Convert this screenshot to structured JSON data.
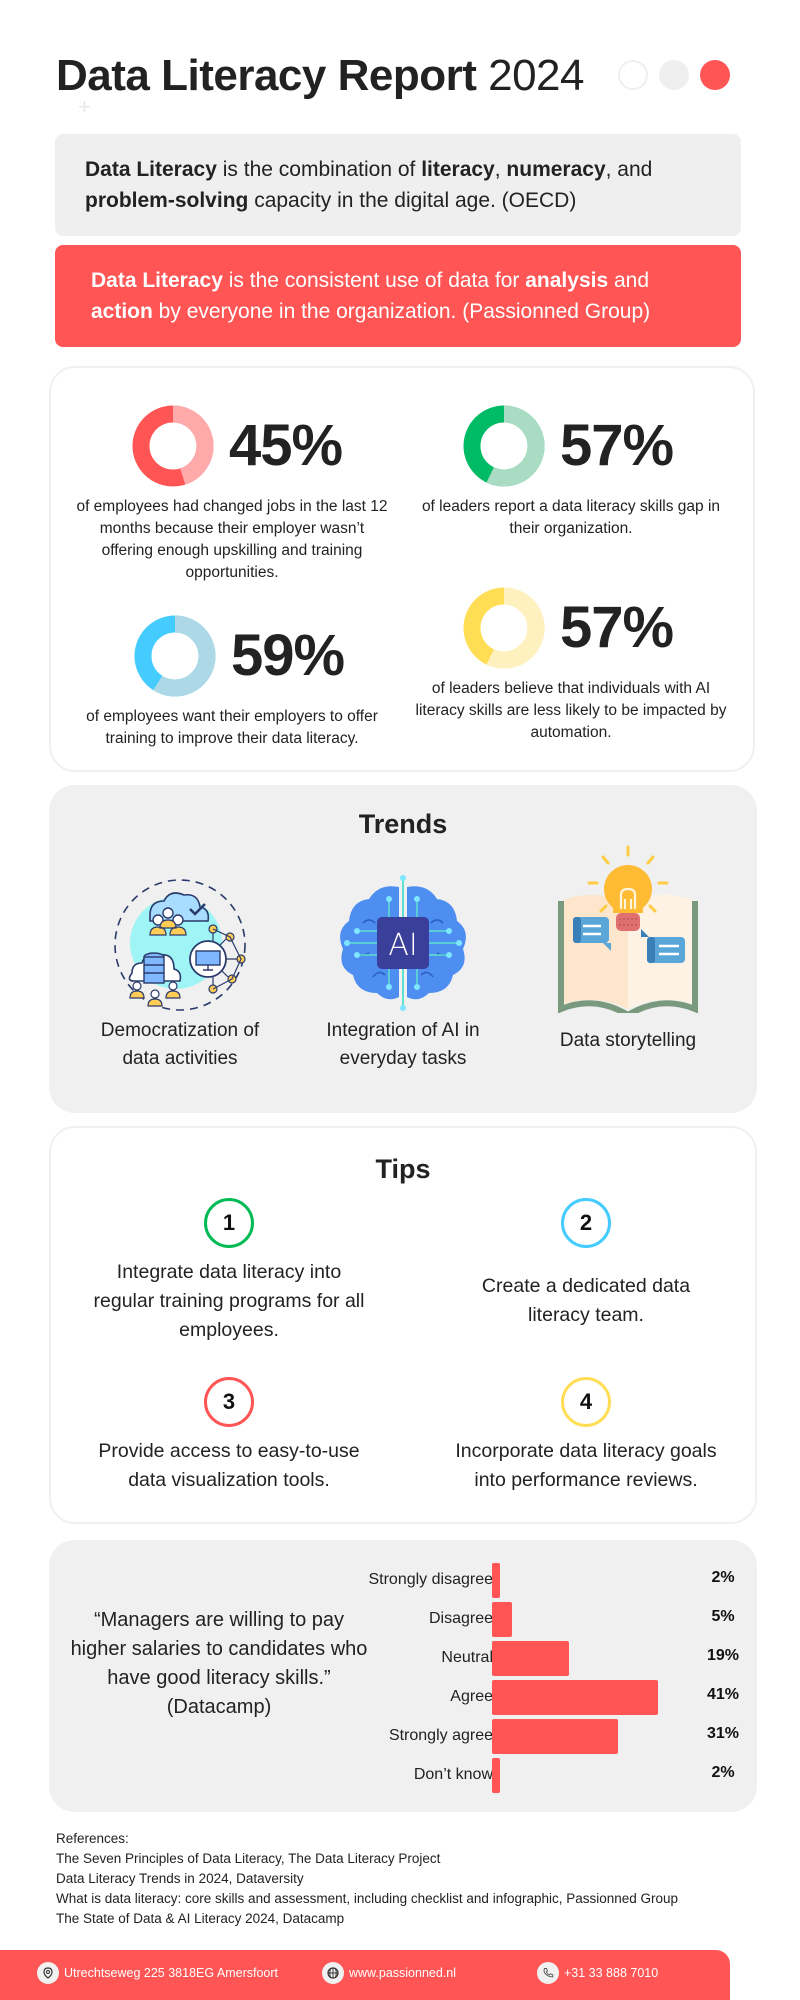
{
  "header": {
    "title_bold": "Data Literacy Report",
    "title_year": "2024",
    "decor_dots": [
      "#ffffff",
      "#efefef",
      "#ff5555"
    ]
  },
  "definitions": {
    "oecd": {
      "parts": [
        {
          "t": "Data Literacy",
          "b": true
        },
        {
          "t": " is the combination of ",
          "b": false
        },
        {
          "t": "literacy",
          "b": true
        },
        {
          "t": ", ",
          "b": false
        },
        {
          "t": "numeracy",
          "b": true
        },
        {
          "t": ", and ",
          "b": false
        },
        {
          "t": "problem-solving",
          "b": true
        },
        {
          "t": " capacity in the digital age. (OECD)",
          "b": false
        }
      ]
    },
    "passionned": {
      "parts": [
        {
          "t": "Data Literacy",
          "b": true
        },
        {
          "t": " is the consistent use of data for ",
          "b": false
        },
        {
          "t": "analysis",
          "b": true
        },
        {
          "t": " and ",
          "b": false
        },
        {
          "t": "action",
          "b": true
        },
        {
          "t": " by everyone in the organization. (Passionned Group)",
          "b": false
        }
      ]
    }
  },
  "stats": [
    {
      "value": 45,
      "label": "45%",
      "desc": "of employees had changed jobs in the last 12 months because their employer wasn’t offering enough upskilling and training opportunities.",
      "color_main": "#ffaaaa",
      "color_rest": "#ff5555"
    },
    {
      "value": 57,
      "label": "57%",
      "desc": "of leaders report a data literacy skills gap in their organization.",
      "color_main": "#aadcc3",
      "color_rest": "#00bb66"
    },
    {
      "value": 59,
      "label": "59%",
      "desc": "of employees want their employers to offer training to improve their data literacy.",
      "color_main": "#add8e6",
      "color_rest": "#44ccff"
    },
    {
      "value": 57,
      "label": "57%",
      "desc": "of leaders believe that individuals with AI literacy skills are less likely to be impacted by automation.",
      "color_main": "#fff0c0",
      "color_rest": "#ffdd55"
    }
  ],
  "trends": {
    "heading": "Trends",
    "items": [
      {
        "icon": "democratization-icon",
        "label_1": "Democratization of",
        "label_2": "data activities"
      },
      {
        "icon": "ai-brain-icon",
        "label_1": "Integration of AI in",
        "label_2": "everyday tasks",
        "icon_text": "AI"
      },
      {
        "icon": "storytelling-book-icon",
        "label_1": "Data storytelling",
        "label_2": ""
      }
    ]
  },
  "tips": {
    "heading": "Tips",
    "items": [
      {
        "num": "1",
        "color": "#00bb55",
        "text": "Integrate data literacy into regular training programs for all employees."
      },
      {
        "num": "2",
        "color": "#44ccff",
        "text": "Create a dedicated data literacy team."
      },
      {
        "num": "3",
        "color": "#ff5555",
        "text": "Provide access to easy-to-use data visualization tools."
      },
      {
        "num": "4",
        "color": "#ffdd55",
        "text": "Incorporate data literacy goals into performance reviews."
      }
    ]
  },
  "survey": {
    "quote": "“Managers are willing to pay higher salaries to candidates who have good literacy skills.”",
    "source": "(Datacamp)"
  },
  "chart_data": {
    "type": "bar",
    "orientation": "horizontal",
    "title": "",
    "categories": [
      "Strongly disagree",
      "Disagree",
      "Neutral",
      "Agree",
      "Strongly agree",
      "Don’t know"
    ],
    "values": [
      2,
      5,
      19,
      41,
      31,
      2
    ],
    "value_labels": [
      "2%",
      "5%",
      "19%",
      "41%",
      "31%",
      "2%"
    ],
    "unit": "%",
    "xlim": [
      0,
      45
    ],
    "grid": false,
    "color": "#ff5555"
  },
  "references": {
    "heading": "References:",
    "items": [
      "The Seven Principles of Data Literacy, The Data Literacy Project",
      "Data Literacy Trends in 2024, Dataversity",
      "What is data literacy: core skills and assessment, including checklist and infographic, Passionned Group",
      "The State of Data & AI Literacy 2024, Datacamp"
    ]
  },
  "footer": {
    "address": "Utrechtseweg 225 3818EG Amersfoort",
    "website": "www.passionned.nl",
    "phone": "+31 33 888 7010"
  }
}
